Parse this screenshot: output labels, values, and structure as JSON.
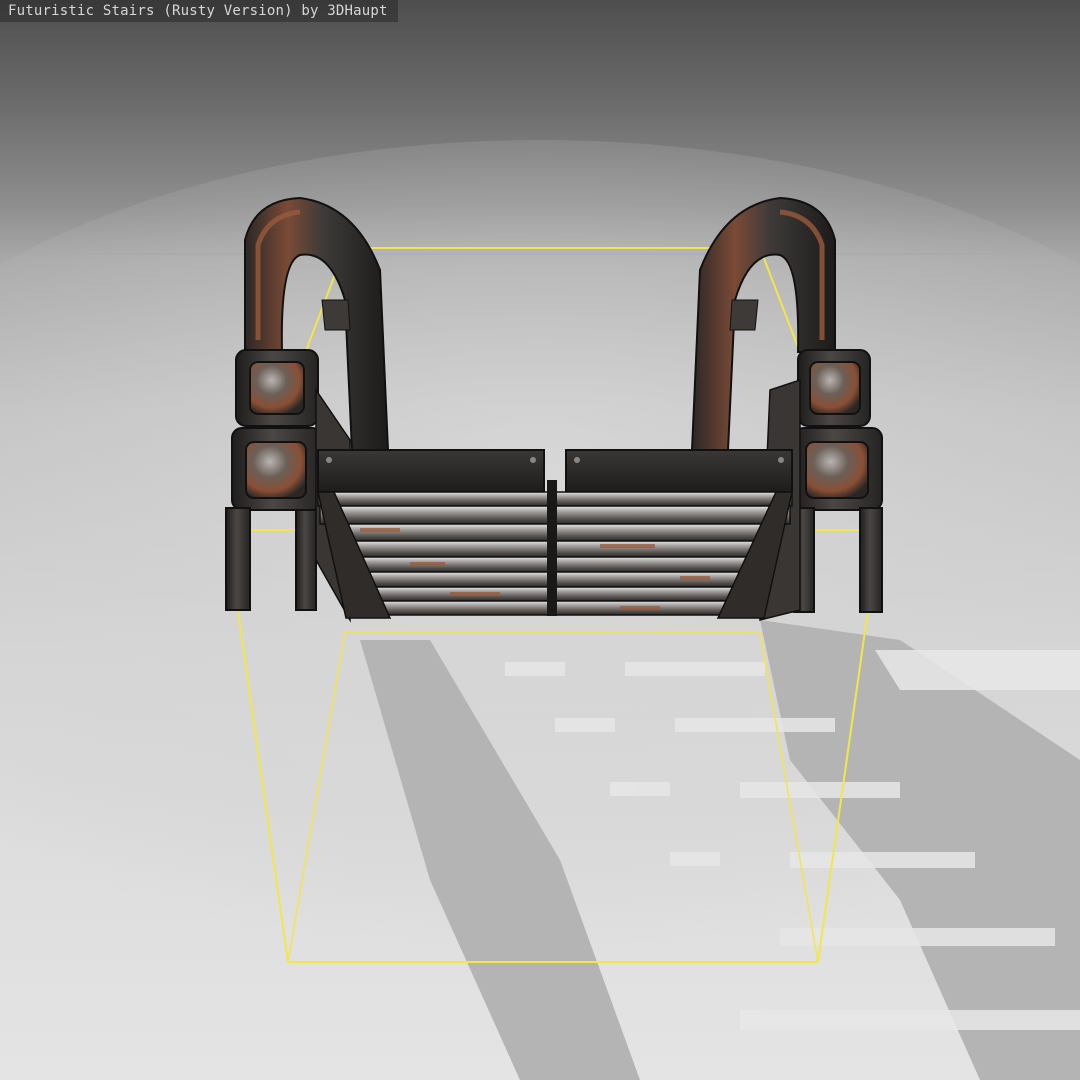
{
  "viewer": {
    "title": "Futuristic Stairs (Rusty Version) by 3DHaupt"
  },
  "colors": {
    "bounding_box": "#f2e64a",
    "metal_dark": "#2c2b2a",
    "metal_mid": "#4a4644",
    "metal_light": "#8f8c8a",
    "rust": "#9a5a3c",
    "shadow": "#b2b2b2"
  },
  "icons": {
    "model": "stairs-model-icon"
  }
}
